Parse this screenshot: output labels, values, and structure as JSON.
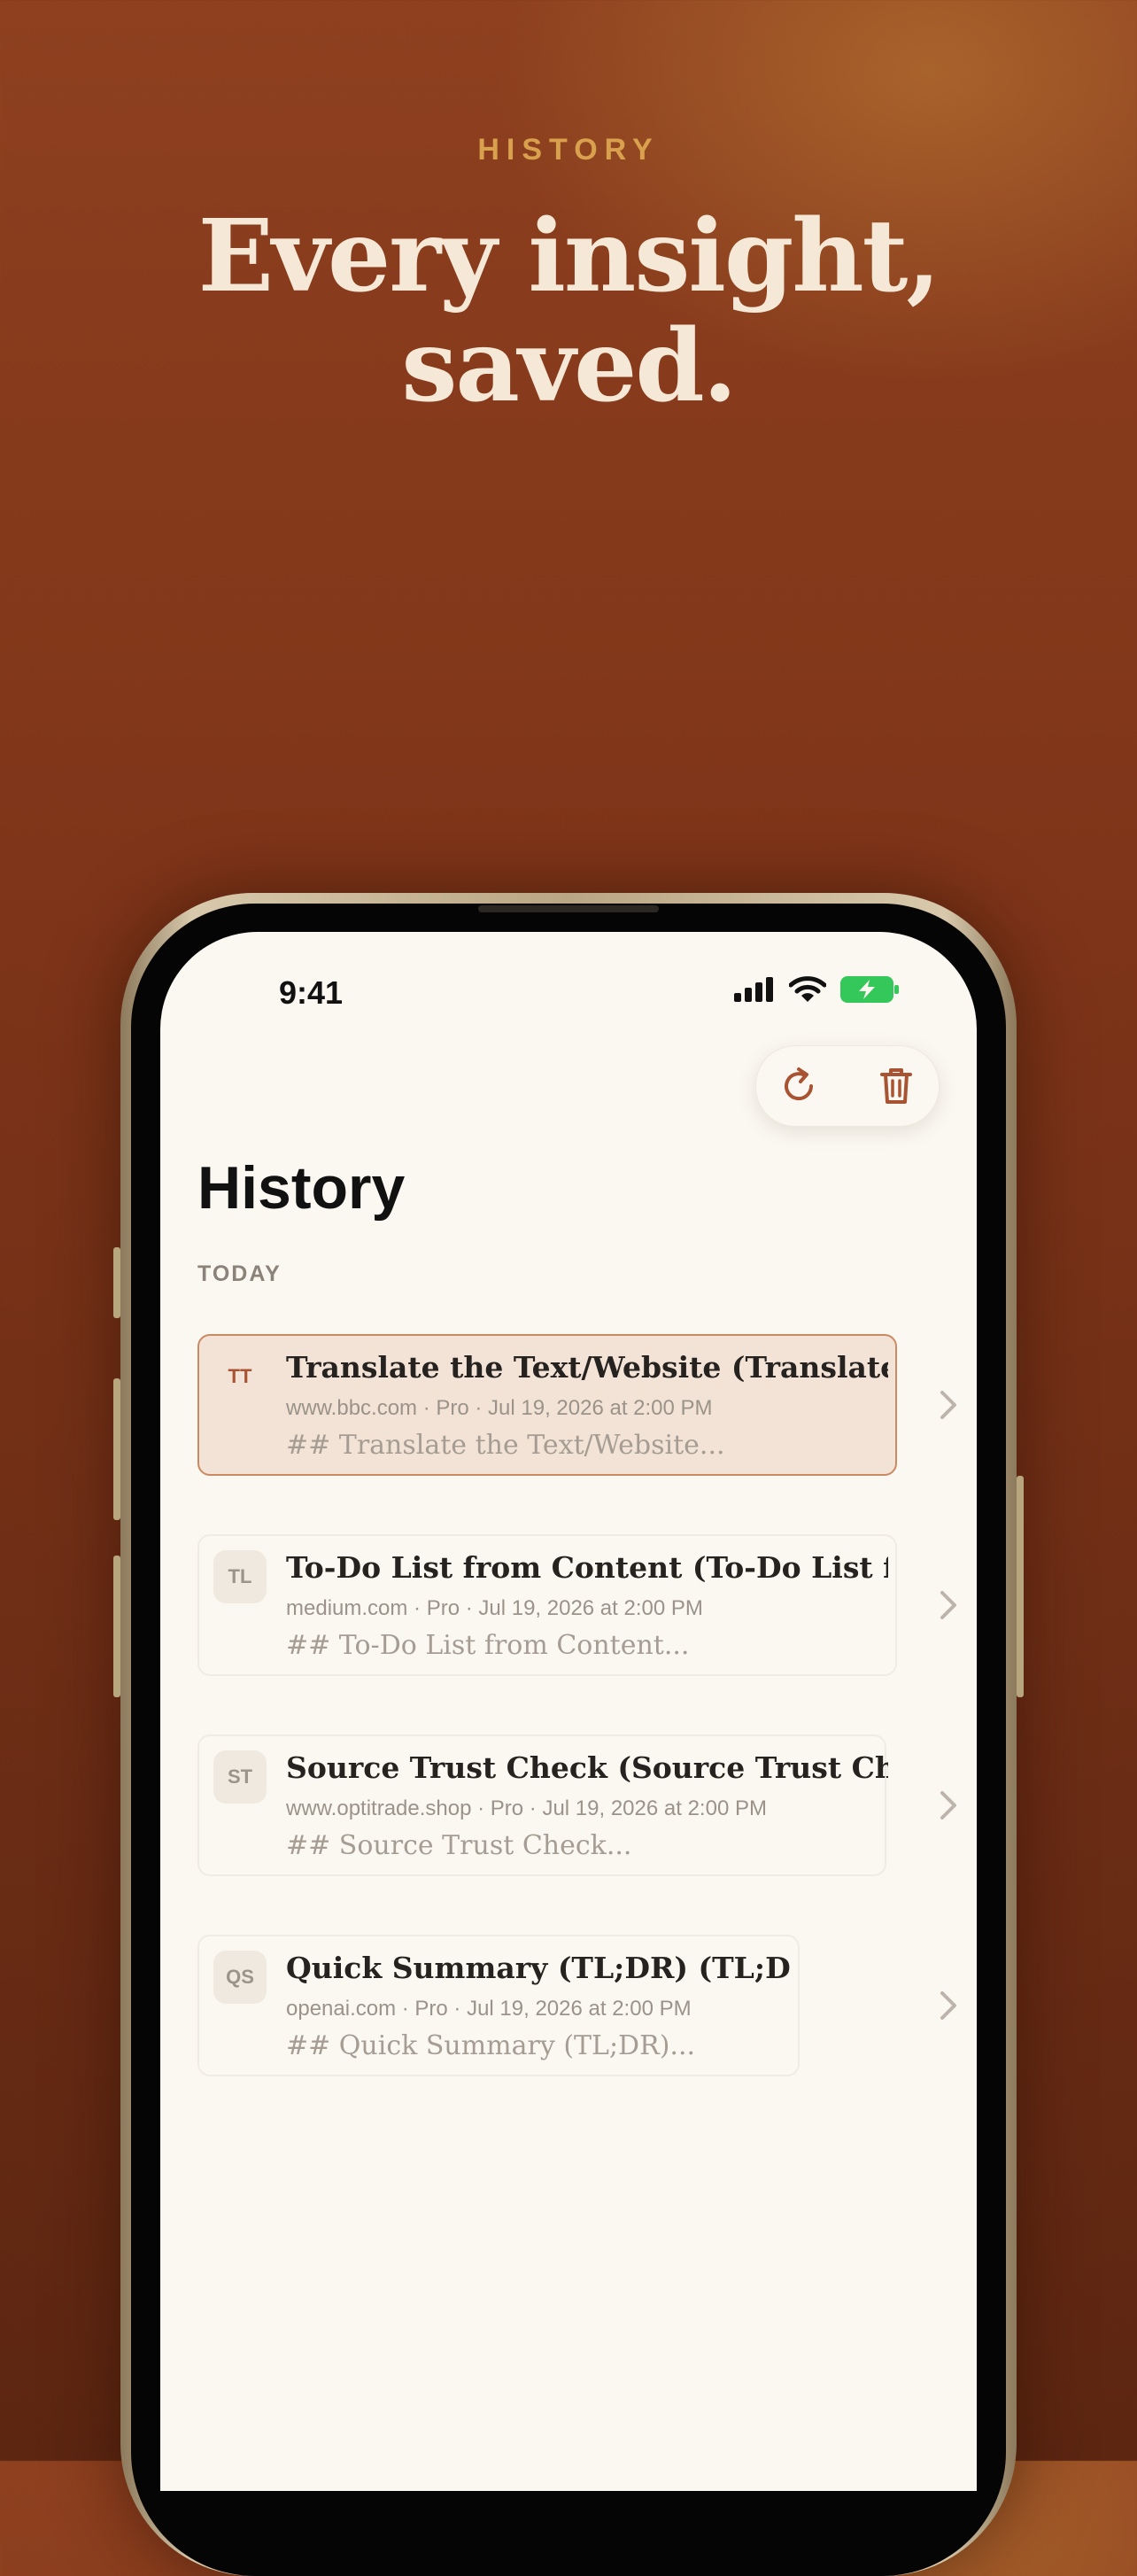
{
  "hero": {
    "eyebrow": "HISTORY",
    "headline_line1": "Every insight,",
    "headline_line2": "saved."
  },
  "status_bar": {
    "time": "9:41"
  },
  "toolbar": {
    "refresh_icon": "refresh-icon",
    "delete_icon": "trash-icon",
    "accent_color": "#a85432"
  },
  "page": {
    "title": "History",
    "section_label": "TODAY"
  },
  "history_items": [
    {
      "badge": "TT",
      "title": "Translate the Text/Website (Translate...",
      "meta": "www.bbc.com · Pro · Jul 19, 2026 at 2:00 PM",
      "preview": "## Translate the Text/Website...",
      "selected": true
    },
    {
      "badge": "TL",
      "title": "To-Do List from Content (To-Do List f...",
      "meta": "medium.com · Pro · Jul 19, 2026 at 2:00 PM",
      "preview": "## To-Do List from Content...",
      "selected": false
    },
    {
      "badge": "ST",
      "title": "Source Trust Check (Source Trust Ch...",
      "meta": "www.optitrade.shop · Pro · Jul 19, 2026 at 2:00 PM",
      "preview": "## Source Trust Check...",
      "selected": false
    },
    {
      "badge": "QS",
      "title": "Quick Summary (TL;DR) (TL;DR)",
      "meta": "openai.com · Pro · Jul 19, 2026 at 2:00 PM",
      "preview": "## Quick Summary (TL;DR)...",
      "selected": false
    }
  ]
}
